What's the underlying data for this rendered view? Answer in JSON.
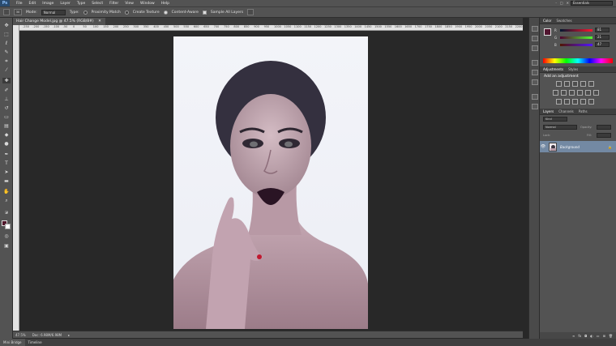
{
  "app": {
    "logo": "Ps"
  },
  "menubar": {
    "items": [
      "File",
      "Edit",
      "Image",
      "Layer",
      "Type",
      "Select",
      "Filter",
      "View",
      "Window",
      "Help"
    ],
    "workspace": "Essentials",
    "window_controls": [
      "-",
      "□",
      "✕"
    ]
  },
  "options_bar": {
    "brush_size": "30",
    "mode_label": "Mode:",
    "mode_value": "Normal",
    "type_label": "Type:",
    "type_options": [
      "Proximity Match",
      "Create Texture",
      "Content-Aware"
    ],
    "selected_type": "Content-Aware",
    "sample_all_layers": "Sample All Layers",
    "sample_checked": true
  },
  "document": {
    "tab_title": "Hair Change Model.jpg @ 47.5% (RGB/8#)",
    "ruler_ticks": [
      "-250",
      "-200",
      "-150",
      "-100",
      "-50",
      "0",
      "50",
      "100",
      "150",
      "200",
      "250",
      "300",
      "350",
      "400",
      "450",
      "500",
      "550",
      "600",
      "650",
      "700",
      "750",
      "800",
      "850",
      "900",
      "950",
      "1000",
      "1050",
      "1100",
      "1150",
      "1200",
      "1250",
      "1300",
      "1350",
      "1400",
      "1450",
      "1500",
      "1550",
      "1600",
      "1650",
      "1700",
      "1750",
      "1800",
      "1850",
      "1900",
      "1950",
      "2000",
      "2050",
      "2100",
      "2150",
      "2200"
    ]
  },
  "statusbar": {
    "zoom": "47.5%",
    "doc_info": "Doc: 6.98M/6.98M"
  },
  "bottom_tabs": [
    "Mini Bridge",
    "Timeline"
  ],
  "color_panel": {
    "tabs": [
      "Color",
      "Swatches"
    ],
    "sliders": [
      {
        "label": "R",
        "value": "81"
      },
      {
        "label": "G",
        "value": "21"
      },
      {
        "label": "B",
        "value": "47"
      }
    ],
    "fg_color": "#51152f",
    "bg_color": "#ffffff"
  },
  "adjustments_panel": {
    "tabs": [
      "Adjustments",
      "Styles"
    ],
    "title": "Add an adjustment"
  },
  "layers_panel": {
    "tabs": [
      "Layers",
      "Channels",
      "Paths"
    ],
    "filter_label": "Kind",
    "blend_mode": "Normal",
    "opacity_label": "Opacity:",
    "lock_label": "Lock:",
    "fill_label": "Fill:",
    "layers": [
      {
        "name": "Background",
        "locked": true,
        "visible": true
      }
    ],
    "footer_icons": [
      "link-icon",
      "fx-icon",
      "mask-icon",
      "adjustment-icon",
      "folder-icon",
      "new-layer-icon",
      "trash-icon"
    ]
  },
  "tools": [
    "move",
    "marquee",
    "lasso",
    "quick-select",
    "crop",
    "eyedropper",
    "healing",
    "brush",
    "clone-stamp",
    "history-brush",
    "eraser",
    "gradient",
    "blur",
    "dodge",
    "pen",
    "type",
    "path-select",
    "shape",
    "hand",
    "zoom"
  ]
}
